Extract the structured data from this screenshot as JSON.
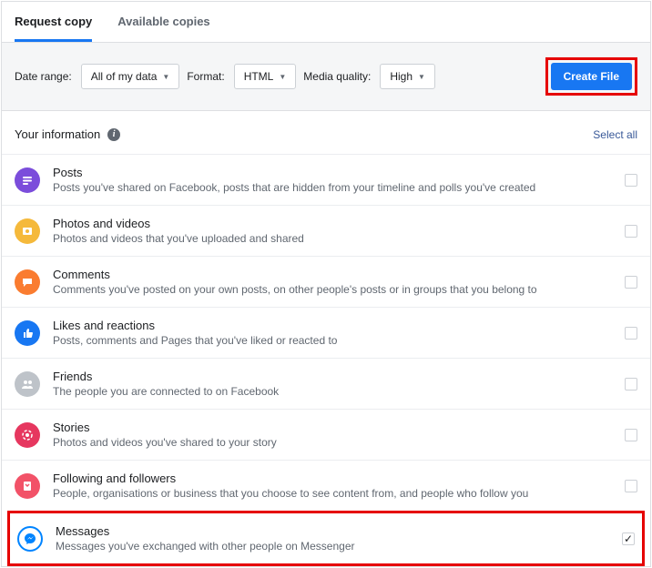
{
  "tabs": {
    "request": "Request copy",
    "available": "Available copies"
  },
  "controls": {
    "dateRangeLabel": "Date range:",
    "dateRangeValue": "All of my data",
    "formatLabel": "Format:",
    "formatValue": "HTML",
    "qualityLabel": "Media quality:",
    "qualityValue": "High",
    "createBtn": "Create File"
  },
  "header": {
    "title": "Your information",
    "selectAll": "Select all"
  },
  "items": [
    {
      "title": "Posts",
      "desc": "Posts you've shared on Facebook, posts that are hidden from your timeline and polls you've created"
    },
    {
      "title": "Photos and videos",
      "desc": "Photos and videos that you've uploaded and shared"
    },
    {
      "title": "Comments",
      "desc": "Comments you've posted on your own posts, on other people's posts or in groups that you belong to"
    },
    {
      "title": "Likes and reactions",
      "desc": "Posts, comments and Pages that you've liked or reacted to"
    },
    {
      "title": "Friends",
      "desc": "The people you are connected to on Facebook"
    },
    {
      "title": "Stories",
      "desc": "Photos and videos you've shared to your story"
    },
    {
      "title": "Following and followers",
      "desc": "People, organisations or business that you choose to see content from, and people who follow you"
    },
    {
      "title": "Messages",
      "desc": "Messages you've exchanged with other people on Messenger"
    }
  ]
}
